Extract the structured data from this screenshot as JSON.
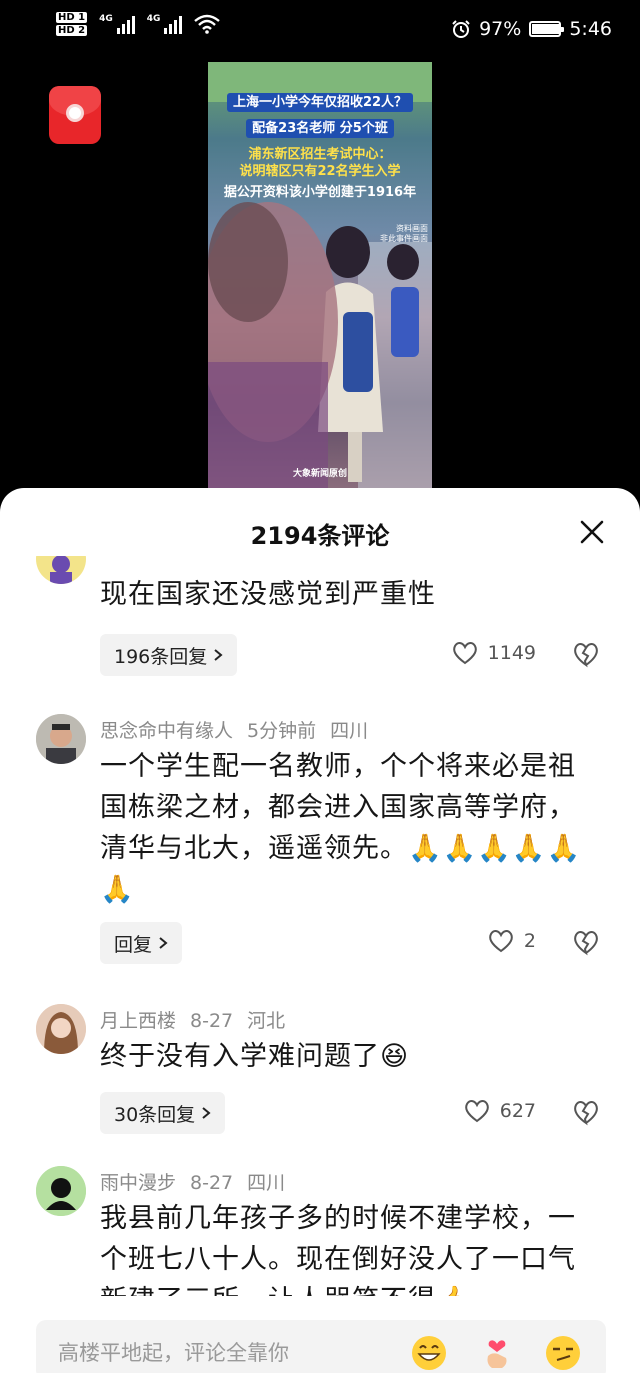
{
  "status_bar": {
    "hd1": "HD 1",
    "hd2": "HD 2",
    "net1": "4G",
    "net2": "4G",
    "battery_text": "97%",
    "battery_level": 0.97,
    "time": "5:46"
  },
  "video": {
    "line1": "上海一小学今年仅招收22人？",
    "line2": "配备23名老师 分5个班",
    "line3": "浦东新区招生考试中心：",
    "line4": "说明辖区只有22名学生入学",
    "line5": "据公开资料该小学创建于1916年",
    "note1": "资料画面",
    "note2": "非此事件画面",
    "source": "大象新闻原创"
  },
  "sheet": {
    "title": "2194条评论"
  },
  "comments": [
    {
      "text": "现在国家还没感觉到严重性",
      "replies": "196条回复",
      "likes": "1149"
    },
    {
      "user": "思念命中有缘人",
      "time": "5分钟前",
      "location": "四川",
      "text": "一个学生配一名教师，个个将来必是祖国栋梁之材，都会进入国家高等学府，清华与北大，遥遥领先。🙏🙏🙏🙏🙏🙏",
      "replies": "回复",
      "likes": "2"
    },
    {
      "user": "月上西楼",
      "time": "8-27",
      "location": "河北",
      "text": "终于没有入学难问题了😆",
      "replies": "30条回复",
      "likes": "627"
    },
    {
      "user": "雨中漫步",
      "time": "8-27",
      "location": "四川",
      "text": "我县前几年孩子多的时候不建学校，一个班七八十人。现在倒好没人了一口气新建了三所，让人哭笑不得👍"
    }
  ],
  "input": {
    "placeholder": "高楼平地起，评论全靠你"
  },
  "icons": {
    "chevron": "chevron-right-icon",
    "like": "heart-outline-icon",
    "dislike": "broken-heart-icon",
    "close": "close-icon"
  },
  "colors": {
    "accent_red": "#e8262a",
    "meta_gray": "#8a8a8a",
    "chip_bg": "#f2f2f2"
  }
}
